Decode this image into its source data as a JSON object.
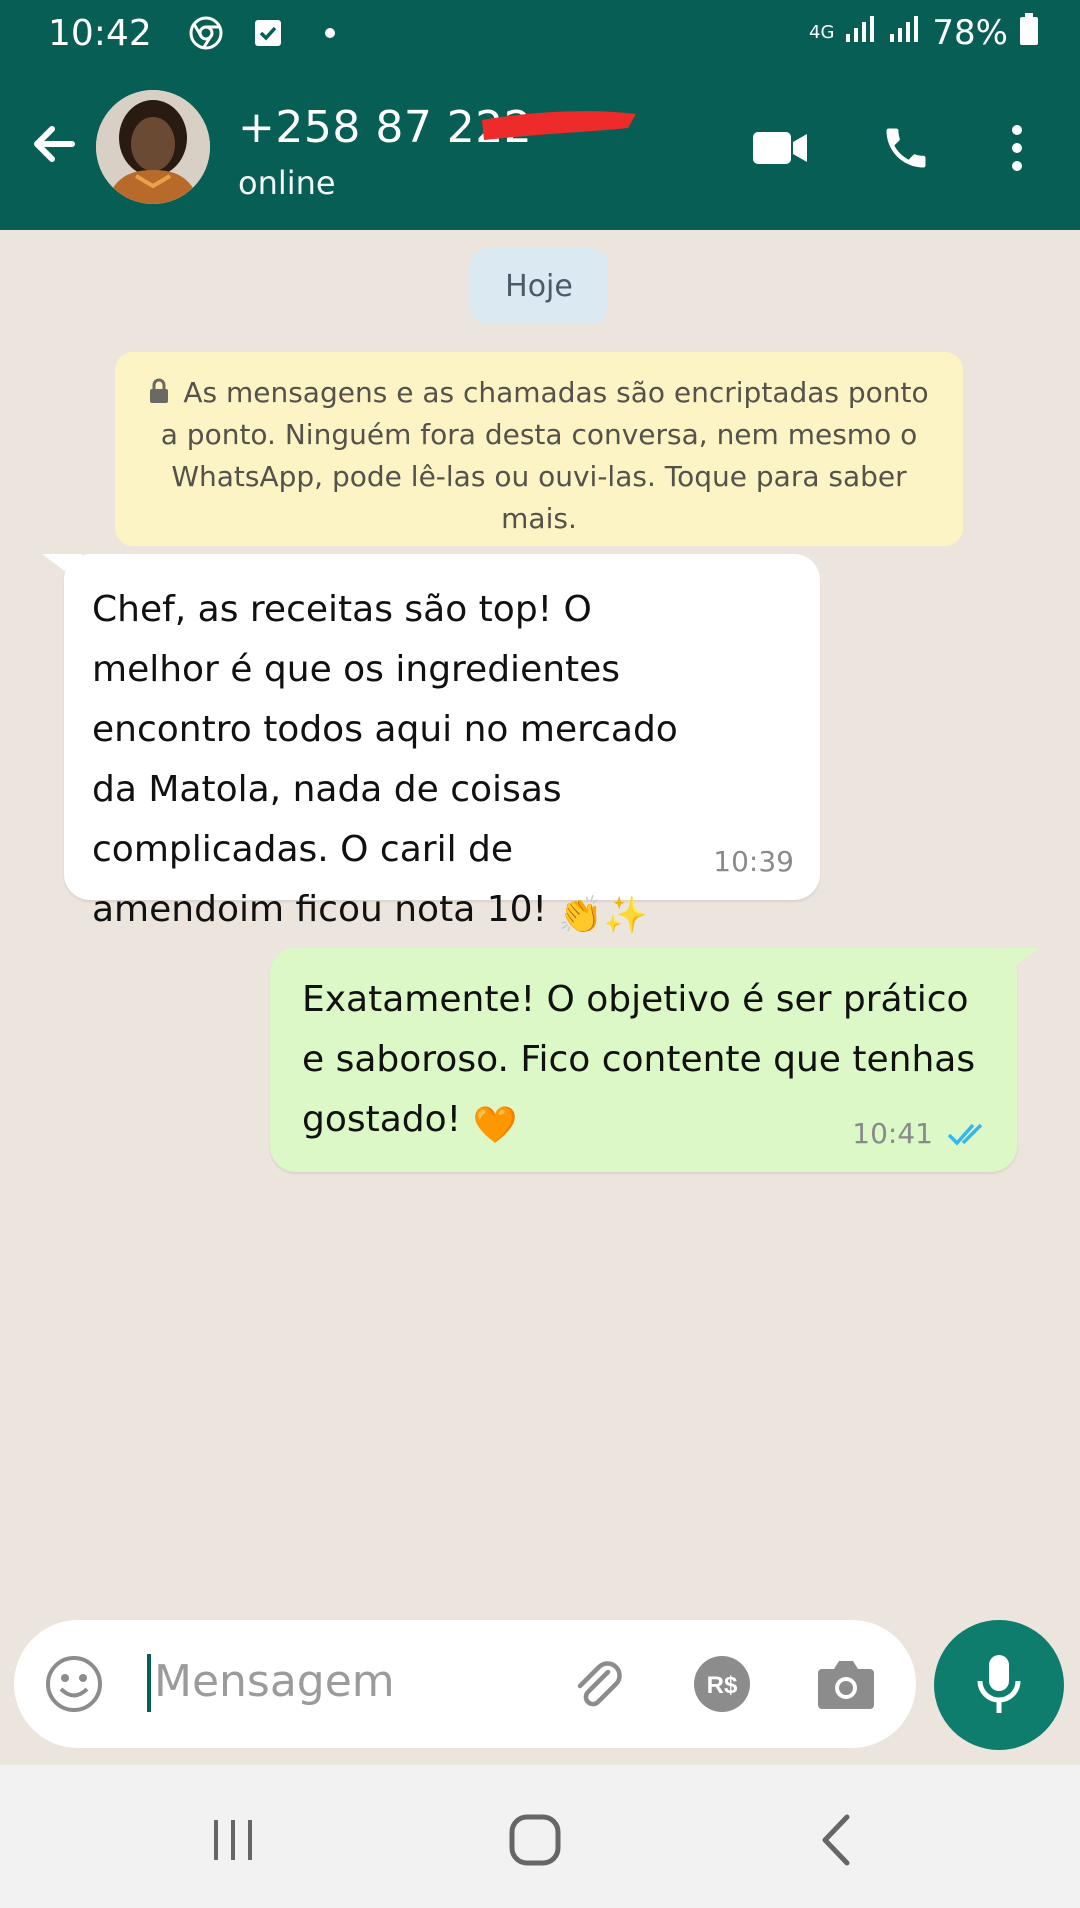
{
  "status_bar": {
    "time": "10:42",
    "network": "4G",
    "battery": "78%"
  },
  "header": {
    "contact_name": "+258 87 222",
    "status": "online"
  },
  "chat": {
    "date_chip": "Hoje",
    "encryption_notice": "As mensagens e as chamadas são encriptadas ponto a ponto. Ninguém fora desta conversa, nem mesmo o WhatsApp, pode lê-las ou ouvi-las. Toque para saber mais.",
    "messages": [
      {
        "direction": "incoming",
        "text": "Chef, as receitas são top! O melhor é que os ingredientes encontro todos aqui no mercado da Matola, nada de coisas complicadas. O caril de amendoim ficou nota 10!",
        "emoji": "👏✨",
        "time": "10:39"
      },
      {
        "direction": "outgoing",
        "text": "Exatamente! O objetivo é ser prático e saboroso. Fico contente que tenhas gostado!",
        "emoji": "🧡",
        "time": "10:41",
        "status": "read"
      }
    ]
  },
  "input": {
    "placeholder": "Mensagem"
  },
  "colors": {
    "brand": "#075e54",
    "incoming_bubble": "#ffffff",
    "outgoing_bubble": "#dcf8c6",
    "read_ticks": "#34b7f1",
    "chat_bg": "#ece5dd"
  }
}
